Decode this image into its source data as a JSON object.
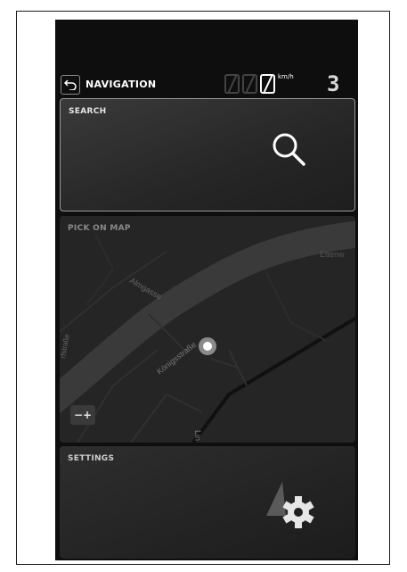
{
  "header": {
    "back_icon": "back-arrow-icon",
    "title": "NAVIGATION",
    "speed_unit": "km/h",
    "gear": "3"
  },
  "search_panel": {
    "label": "SEARCH",
    "icon": "search-icon"
  },
  "map_panel": {
    "label": "PICK ON MAP",
    "street_labels": [
      "Almgasse",
      "Königsstraße",
      "Lin",
      "Ettenw",
      "rfstraße"
    ],
    "zoom_label": "−+"
  },
  "settings_panel": {
    "label": "SETTINGS",
    "icon": "settings-gear-icon"
  },
  "colors": {
    "background": "#0e0e0e",
    "panel_border": "#9a9a9a",
    "text": "#ffffff"
  }
}
